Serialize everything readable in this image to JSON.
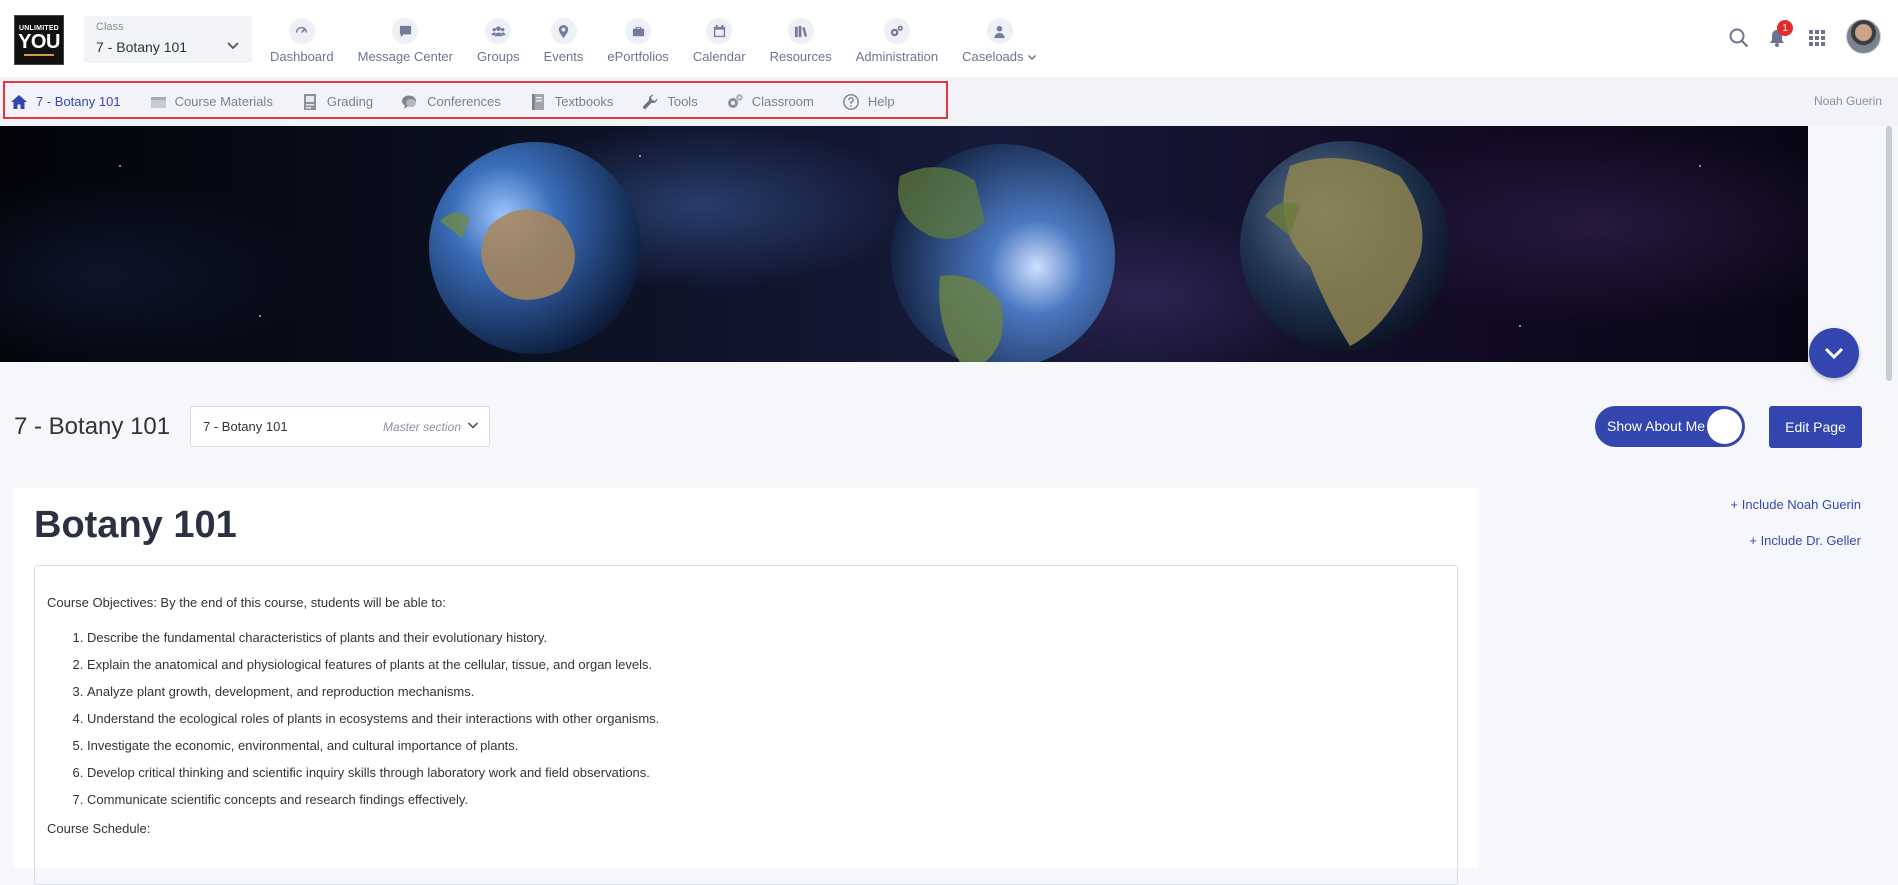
{
  "logo": {
    "line1": "UNLIMITED",
    "line2": "YOU"
  },
  "class_select": {
    "caption": "Class",
    "value": "7 - Botany 101"
  },
  "main_nav": [
    {
      "label": "Dashboard",
      "icon": "gauge-icon"
    },
    {
      "label": "Message Center",
      "icon": "chat-icon"
    },
    {
      "label": "Groups",
      "icon": "users-icon"
    },
    {
      "label": "Events",
      "icon": "map-pin-icon"
    },
    {
      "label": "ePortfolios",
      "icon": "briefcase-icon"
    },
    {
      "label": "Calendar",
      "icon": "calendar-icon"
    },
    {
      "label": "Resources",
      "icon": "books-icon"
    },
    {
      "label": "Administration",
      "icon": "gears-icon"
    },
    {
      "label": "Caseloads",
      "icon": "person-icon"
    }
  ],
  "header_right": {
    "notification_count": "1"
  },
  "sub_nav": [
    {
      "label": "7 - Botany 101",
      "icon": "home-icon"
    },
    {
      "label": "Course Materials",
      "icon": "folder-icon"
    },
    {
      "label": "Grading",
      "icon": "gradebook-icon"
    },
    {
      "label": "Conferences",
      "icon": "conference-icon"
    },
    {
      "label": "Textbooks",
      "icon": "textbook-icon"
    },
    {
      "label": "Tools",
      "icon": "wrench-icon"
    },
    {
      "label": "Classroom",
      "icon": "cog-icon"
    },
    {
      "label": "Help",
      "icon": "help-icon"
    }
  ],
  "user_name": "Noah Guerin",
  "page": {
    "title": "7 - Botany 101",
    "section_select": {
      "value": "7 - Botany 101",
      "meta": "Master section"
    },
    "toggle_label": "Show About Me",
    "edit_label": "Edit Page"
  },
  "content": {
    "heading": "Botany 101",
    "objectives_intro": "Course Objectives: By the end of this course, students will be able to:",
    "objectives": [
      "Describe the fundamental characteristics of plants and their evolutionary history.",
      "Explain the anatomical and physiological features of plants at the cellular, tissue, and organ levels.",
      "Analyze plant growth, development, and reproduction mechanisms.",
      "Understand the ecological roles of plants in ecosystems and their interactions with other organisms.",
      "Investigate the economic, environmental, and cultural importance of plants.",
      "Develop critical thinking and scientific inquiry skills through laboratory work and field observations.",
      "Communicate scientific concepts and research findings effectively."
    ],
    "schedule_label": "Course Schedule:"
  },
  "includes": [
    "+ Include Noah Guerin",
    "+ Include Dr. Geller"
  ],
  "colors": {
    "accent": "#3346b0",
    "highlight_border": "#e0383c",
    "badge": "#e22b2b"
  }
}
